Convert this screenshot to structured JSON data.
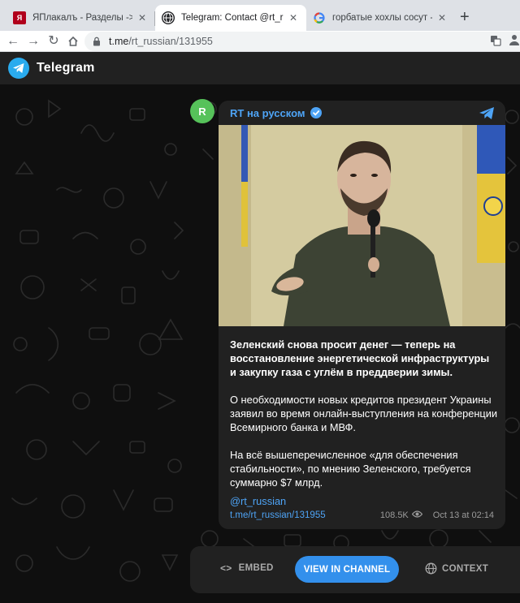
{
  "browser": {
    "tabs": [
      {
        "title": "ЯПлакалъ - Разделы -> Цитиру",
        "icon": "yaplakal-favicon",
        "active": false
      },
      {
        "title": "Telegram: Contact @rt_russian",
        "icon": "telegram-favicon",
        "active": true
      },
      {
        "title": "горбатые хохлы сосут - Поиск в",
        "icon": "google-favicon",
        "active": false
      }
    ],
    "address": {
      "host": "t.me",
      "path": "/rt_russian/131955"
    }
  },
  "telegram": {
    "app_title": "Telegram",
    "post": {
      "avatar_letter": "R",
      "channel_name": "RT на русском",
      "paragraphs": [
        "Зеленский снова просит денег — теперь на восстановление энергетической инфраструктуры и закупку газа с углём в преддверии зимы.",
        "О необходимости новых кредитов президент Украины заявил во время онлайн-выступления на конференции Всемирного банка и МВФ.",
        "На всё вышеперечисленное «для обеспечения стабильности», по мнению Зеленского, требуется суммарно $7 млрд."
      ],
      "hashtag": "@rt_russian",
      "link": "t.me/rt_russian/131955",
      "views": "108.5K",
      "date": "Oct 13 at 02:14"
    },
    "actions": {
      "embed": "EMBED",
      "view_in_channel": "VIEW IN CHANNEL",
      "context": "CONTEXT"
    }
  }
}
